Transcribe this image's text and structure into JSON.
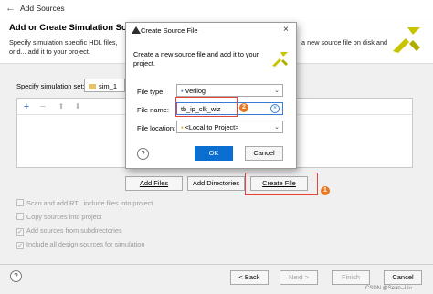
{
  "window": {
    "title": "Add Sources"
  },
  "header": {
    "heading": "Add or Create Simulation Sources",
    "description_left": "Specify simulation specific HDL files, or d... add it to your project.",
    "description_right": "a new source file on disk and"
  },
  "simulation_set": {
    "label": "Specify simulation set:",
    "value": "sim_1"
  },
  "toolbar": {
    "add": "+",
    "remove": "−",
    "up": "⬆",
    "down": "⬇"
  },
  "file_buttons": {
    "add_files": "Add Files",
    "add_directories": "Add Directories",
    "create_file": "Create File"
  },
  "options": [
    {
      "label": "Scan and add RTL include files into project",
      "checked": false
    },
    {
      "label": "Copy sources into project",
      "checked": false
    },
    {
      "label": "Add sources from subdirectories",
      "checked": true
    },
    {
      "label": "Include all design sources for simulation",
      "checked": true
    }
  ],
  "nav": {
    "help": "?",
    "back": "< Back",
    "next": "Next >",
    "finish": "Finish",
    "cancel": "Cancel"
  },
  "dialog": {
    "title": "Create Source File",
    "close": "×",
    "description": "Create a new source file and add it to your project.",
    "file_type_label": "File type:",
    "file_type_value": "Verilog",
    "file_name_label": "File name:",
    "file_name_value": "tb_ip_clk_wiz",
    "file_location_label": "File location:",
    "file_location_value": "<Local to Project>",
    "ok": "OK",
    "cancel": "Cancel",
    "help": "?"
  },
  "annotations": {
    "badge_1": "1",
    "badge_2": "2"
  },
  "watermark": "CSDN @Sean--Liu",
  "colors": {
    "callout": "#e0463a",
    "badge": "#e87722",
    "ok_button": "#0a6fd1",
    "logo_yellow": "#c8c400"
  }
}
